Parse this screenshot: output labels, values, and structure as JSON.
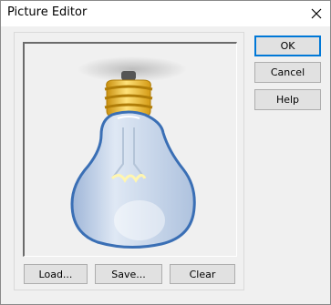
{
  "window": {
    "title": "Picture Editor"
  },
  "actions": {
    "ok": "OK",
    "cancel": "Cancel",
    "help": "Help"
  },
  "picture_buttons": {
    "load": "Load...",
    "save": "Save...",
    "clear": "Clear"
  },
  "image": {
    "content": "light-bulb"
  },
  "icons": {
    "close": "close-icon"
  },
  "colors": {
    "default_button_border": "#0078d7",
    "bulb_outline": "#3a6fb5",
    "bulb_base": "#e8b520"
  }
}
